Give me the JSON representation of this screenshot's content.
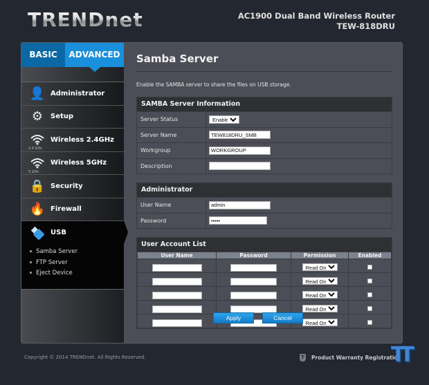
{
  "header": {
    "logo": "TRENDnet",
    "product_line": "AC1900 Dual Band Wireless Router",
    "model": "TEW-818DRU"
  },
  "tabs": [
    {
      "label": "BASIC",
      "active": false
    },
    {
      "label": "ADVANCED",
      "active": true
    }
  ],
  "sidebar": {
    "items": [
      {
        "label": "Administrator",
        "icon": "administrator-icon"
      },
      {
        "label": "Setup",
        "icon": "gears-icon"
      },
      {
        "label": "Wireless 2.4GHz",
        "icon": "wifi-icon",
        "sub": "2.4 GHz"
      },
      {
        "label": "Wireless 5GHz",
        "icon": "wifi-icon",
        "sub": "5 GHz"
      },
      {
        "label": "Security",
        "icon": "lock-key-icon"
      },
      {
        "label": "Firewall",
        "icon": "firewall-icon"
      },
      {
        "label": "USB",
        "icon": "usb-icon",
        "active": true
      }
    ],
    "usb_submenu": [
      "Samba Server",
      "FTP Server",
      "Eject Device"
    ]
  },
  "page": {
    "title": "Samba Server",
    "description": "Enable the SAMBA server to share the files on USB storage."
  },
  "samba_info": {
    "heading": "SAMBA Server Information",
    "server_status_label": "Server Status",
    "server_status_value": "Enabled",
    "server_name_label": "Server Name",
    "server_name_value": "TEW818DRU_SMB",
    "workgroup_label": "Workgroup",
    "workgroup_value": "WORKGROUP",
    "description_label": "Description",
    "description_value": ""
  },
  "administrator": {
    "heading": "Administrator",
    "username_label": "User Name",
    "username_value": "admin",
    "password_label": "Password",
    "password_value": "admin"
  },
  "user_accounts": {
    "heading": "User Account List",
    "columns": [
      "User Name",
      "Password",
      "Permission",
      "Enabled"
    ],
    "rows": [
      {
        "username": "",
        "password": "",
        "permission": "Read Only",
        "enabled": false
      },
      {
        "username": "",
        "password": "",
        "permission": "Read Only",
        "enabled": false
      },
      {
        "username": "",
        "password": "",
        "permission": "Read Only",
        "enabled": false
      },
      {
        "username": "",
        "password": "",
        "permission": "Read Only",
        "enabled": false
      },
      {
        "username": "",
        "password": "",
        "permission": "Read Only",
        "enabled": false
      }
    ]
  },
  "buttons": {
    "apply": "Apply",
    "cancel": "Cancel"
  },
  "footer": {
    "copyright": "Copyright © 2014 TRENDnet. All Rights Reserved.",
    "warranty": "Product Warranty Registration"
  },
  "colors": {
    "accent": "#1a90dd",
    "basic_tab": "#0c67a5"
  }
}
